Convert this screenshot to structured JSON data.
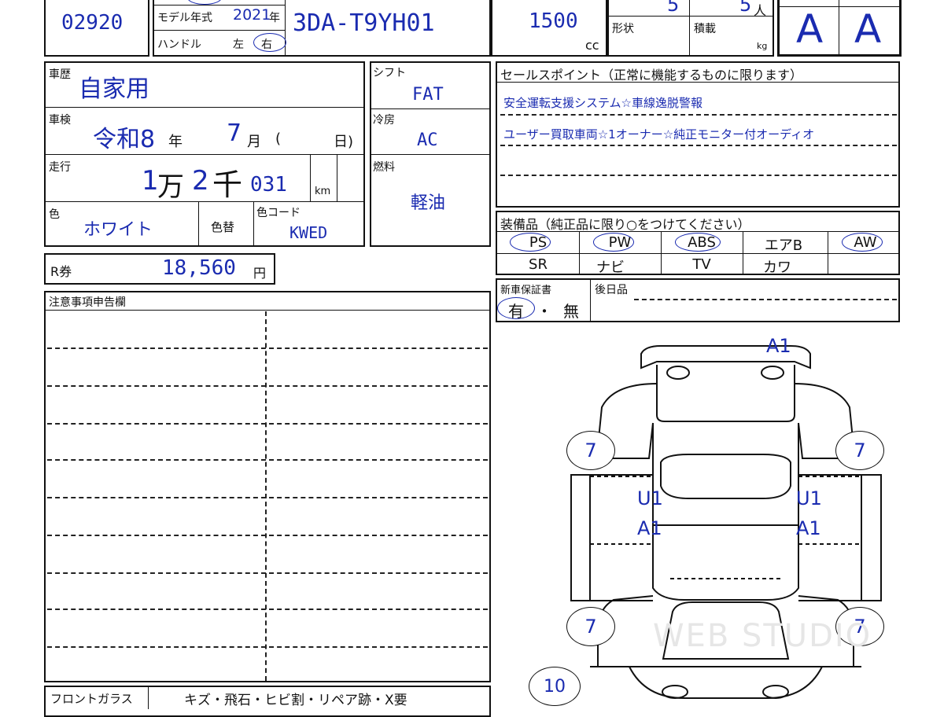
{
  "header": {
    "lot_number": "02920",
    "model_year_label": "モデル年式",
    "model_year": "2021",
    "model_year_suffix": "年",
    "steering_label": "ハンドル",
    "steering_left": "左",
    "steering_right": "右",
    "model_code": "3DA-T9YH01",
    "displacement": "1500",
    "displacement_unit": "cc",
    "doors": "5",
    "seats": "5",
    "seats_unit": "人",
    "shape_label": "形状",
    "load_label": "積載",
    "load_unit": "kg",
    "grade_overall": "A",
    "grade_interior": "A"
  },
  "history": {
    "label": "車歴",
    "value": "自家用",
    "inspection_label": "車検",
    "inspection_era": "令和8",
    "inspection_year_suffix": "年",
    "inspection_month": "7",
    "inspection_month_suffix": "月",
    "inspection_day_open": "(",
    "inspection_day_close": "日)",
    "mileage_label": "走行",
    "mileage_man": "1",
    "mileage_man_unit": "万",
    "mileage_sen": "2",
    "mileage_sen_unit": "千",
    "mileage_rest": "031",
    "mileage_unit": "km",
    "color_label": "色",
    "color_value": "ホワイト",
    "color_change_label": "色替",
    "color_code_label": "色コード",
    "color_code": "KWED"
  },
  "drivetrain": {
    "shift_label": "シフト",
    "shift": "FAT",
    "ac_label": "冷房",
    "ac": "AC",
    "fuel_label": "燃料",
    "fuel": "軽油"
  },
  "recycle": {
    "label": "R券",
    "amount": "18,560",
    "unit": "円"
  },
  "sales_points": {
    "title": "セールスポイント（正常に機能するものに限ります）",
    "lines": [
      "安全運転支援システム☆車線逸脱警報",
      "ユーザー買取車両☆1オーナー☆純正モニター付オーディオ"
    ]
  },
  "equipment": {
    "title": "装備品（純正品に限り○をつけてください）",
    "row1": [
      "PS",
      "PW",
      "ABS",
      "エアB",
      "AW"
    ],
    "row2": [
      "SR",
      "ナビ",
      "TV",
      "カワ",
      ""
    ]
  },
  "warranty": {
    "label": "新車保証書",
    "yes": "有",
    "sep": "・",
    "no": "無",
    "aftermarket_label": "後日品"
  },
  "notes": {
    "title": "注意事項申告欄"
  },
  "windshield": {
    "label": "フロントガラス",
    "options": "キズ・飛石・ヒビ割・リペア跡・X要"
  },
  "damage": {
    "rear_bumper": "A1",
    "tire_fl": "7",
    "tire_fr": "7",
    "tire_rl": "7",
    "tire_rr": "7",
    "side_left_1": "U1",
    "side_left_2": "A1",
    "side_right_1": "U1",
    "side_right_2": "A1",
    "front": "10"
  },
  "watermark": "WEB STUDIO"
}
